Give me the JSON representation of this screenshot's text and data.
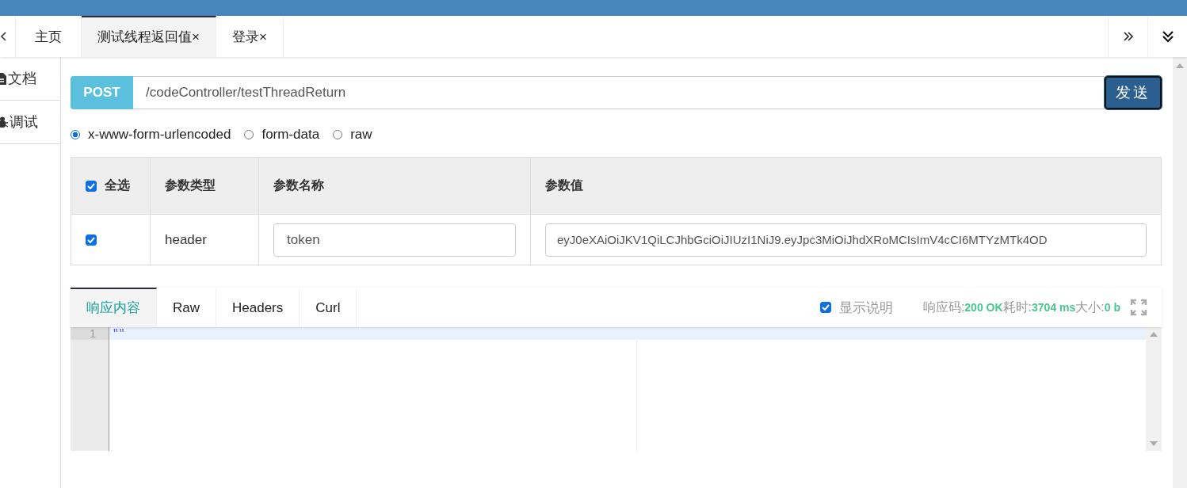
{
  "tabs": [
    {
      "label": "主页",
      "selected": false
    },
    {
      "label": "测试线程返回值",
      "close": "×",
      "selected": true
    },
    {
      "label": "登录",
      "close": "×",
      "selected": false
    }
  ],
  "sidebar": {
    "items": [
      {
        "label": "文档",
        "kind": "file"
      },
      {
        "label": "调试",
        "kind": "bug"
      }
    ]
  },
  "request": {
    "method": "POST",
    "url": "/codeController/testThreadReturn",
    "send": "发送"
  },
  "body_types": [
    {
      "label": "x-www-form-urlencoded",
      "selected": true
    },
    {
      "label": "form-data",
      "selected": false
    },
    {
      "label": "raw",
      "selected": false
    }
  ],
  "params": {
    "select_all": {
      "label": "全选",
      "checked": true
    },
    "columns": [
      "参数类型",
      "参数名称",
      "参数值"
    ],
    "rows": [
      {
        "checked": true,
        "type": "header",
        "name": "token",
        "value": "eyJ0eXAiOiJKV1QiLCJhbGciOiJIUzI1NiJ9.eyJpc3MiOiJhdXRoMCIsImV4cCI6MTYzMTk4OD"
      }
    ]
  },
  "response": {
    "tabs": [
      {
        "label": "响应内容",
        "selected": true
      },
      {
        "label": "Raw",
        "selected": false
      },
      {
        "label": "Headers",
        "selected": false
      },
      {
        "label": "Curl",
        "selected": false
      }
    ],
    "show_description": {
      "label": "显示说明",
      "checked": true
    },
    "status": [
      {
        "label": "响应码:",
        "value": "200 OK"
      },
      {
        "label": "耗时:",
        "value": "3704 ms"
      },
      {
        "label": "大小:",
        "value": "0 b"
      }
    ],
    "lines": [
      {
        "number": "1",
        "text": "\"\"",
        "active": true
      }
    ]
  }
}
